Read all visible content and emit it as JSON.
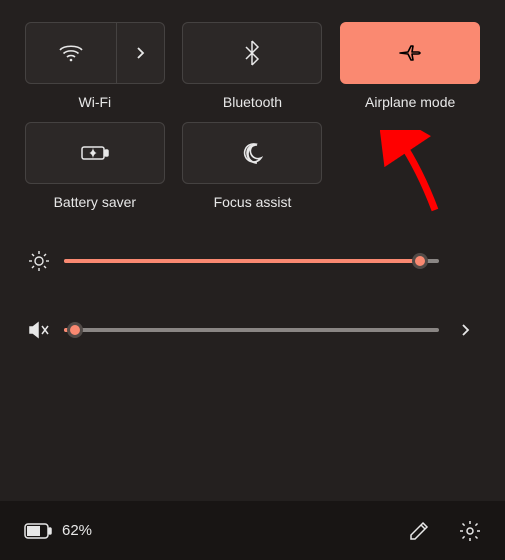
{
  "tiles": {
    "wifi": {
      "label": "Wi-Fi",
      "active": false
    },
    "bluetooth": {
      "label": "Bluetooth",
      "active": false
    },
    "airplane": {
      "label": "Airplane mode",
      "active": true
    },
    "battery_saver": {
      "label": "Battery saver",
      "active": false
    },
    "focus_assist": {
      "label": "Focus assist",
      "active": false
    }
  },
  "sliders": {
    "brightness": {
      "value": 95
    },
    "volume": {
      "value": 3,
      "muted": true
    }
  },
  "bottom": {
    "battery_percent": "62%"
  },
  "colors": {
    "accent": "#fa8971"
  }
}
